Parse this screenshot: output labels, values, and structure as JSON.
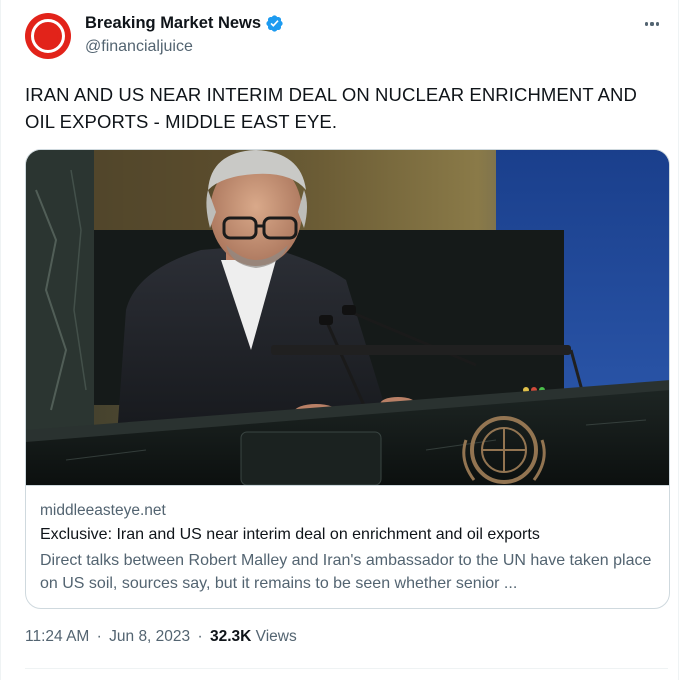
{
  "author": {
    "display_name": "Breaking Market News",
    "handle": "@financialjuice",
    "verified": true,
    "avatar_icon": "red-circle-logo",
    "brand_color": "#e2231a",
    "verified_color": "#1d9bf0"
  },
  "tweet": {
    "text": "IRAN AND US NEAR INTERIM DEAL ON NUCLEAR ENRICHMENT AND OIL EXPORTS - MIDDLE EAST EYE."
  },
  "link_card": {
    "image_icon": "news-photo-speaker-at-un-podium",
    "domain": "middleeasteye.net",
    "title": "Exclusive: Iran and US near interim deal on enrichment and oil exports",
    "description": "Direct talks between Robert Malley and Iran's ambassador to the UN have taken place on US soil, sources say, but it remains to be seen whether senior ..."
  },
  "meta": {
    "time": "11:24 AM",
    "date": "Jun 8, 2023",
    "separator": "·",
    "views_count": "32.3K",
    "views_label": "Views"
  },
  "icons": {
    "more": "more-options-icon"
  }
}
